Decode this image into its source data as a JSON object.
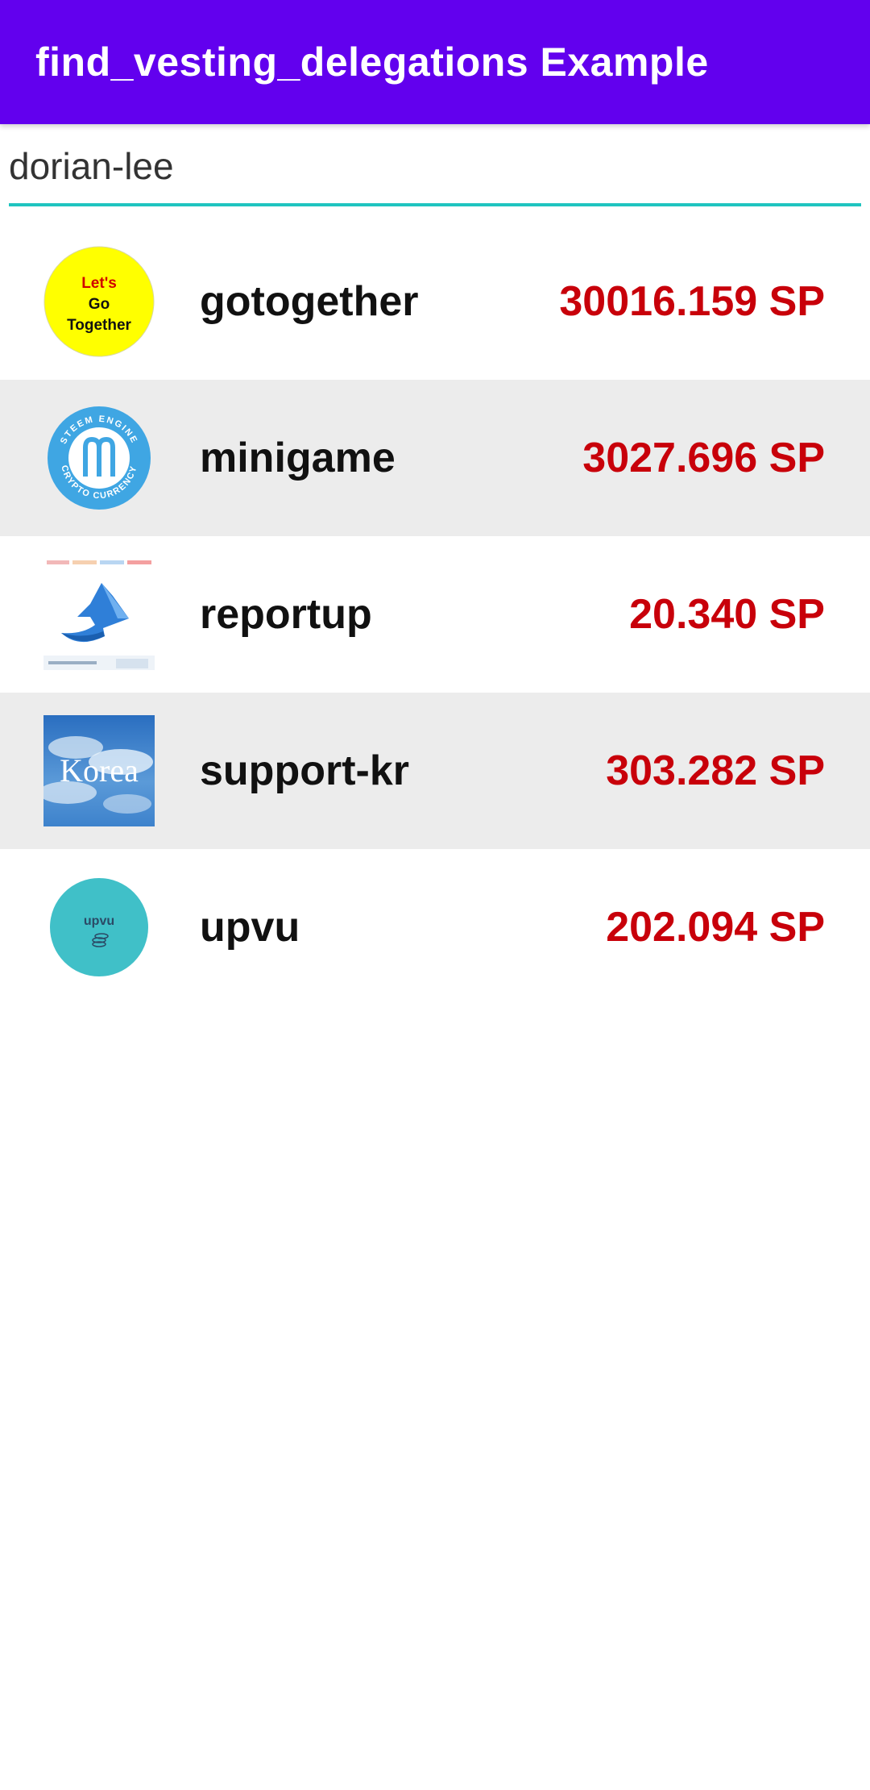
{
  "app_bar": {
    "title": "find_vesting_delegations Example",
    "color": "#6200ee"
  },
  "search": {
    "value": "dorian-lee",
    "accent_color": "#1fc4c0"
  },
  "delegations": [
    {
      "avatar_icon": "lets-go-together-logo",
      "avatar_text": [
        "Let's",
        "Go",
        "Together"
      ],
      "name": "gotogether",
      "amount": "30016.159 SP"
    },
    {
      "avatar_icon": "steem-engine-crypto-currency-logo",
      "avatar_text": [
        "STEEM ENGINE",
        "CRYPTO CURRENCY"
      ],
      "name": "minigame",
      "amount": "3027.696 SP"
    },
    {
      "avatar_icon": "blue-up-arrow-icon",
      "name": "reportup",
      "amount": "20.340 SP"
    },
    {
      "avatar_icon": "korea-sky-image",
      "avatar_text": [
        "Korea"
      ],
      "name": "support-kr",
      "amount": "303.282 SP"
    },
    {
      "avatar_icon": "upvu-coins-logo",
      "avatar_text": [
        "upvu"
      ],
      "name": "upvu",
      "amount": "202.094 SP"
    }
  ],
  "colors": {
    "amount": "#c8000a",
    "alt_row": "#ececec"
  }
}
